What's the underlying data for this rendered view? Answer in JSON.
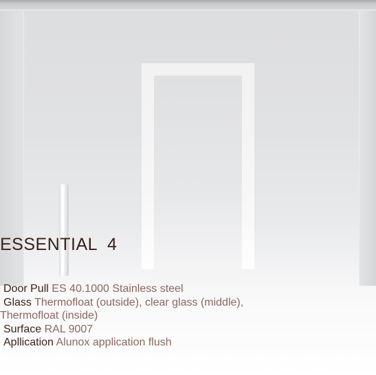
{
  "product": {
    "name": "ESSENTIAL  4"
  },
  "specs": [
    {
      "label": "Door Pull",
      "value": "ES 40.1000 Stainless steel"
    },
    {
      "label": "Glass",
      "value": "Thermofloat (outside), clear glass (middle),",
      "continuation": "Thermofloat (inside)"
    },
    {
      "label": "Surface",
      "value": "RAL 9007"
    },
    {
      "label": "Apllication",
      "value": "Alunox application flush"
    }
  ],
  "colors": {
    "title": "#3b1f16",
    "label": "#3b1f16",
    "value": "#8a675e"
  }
}
